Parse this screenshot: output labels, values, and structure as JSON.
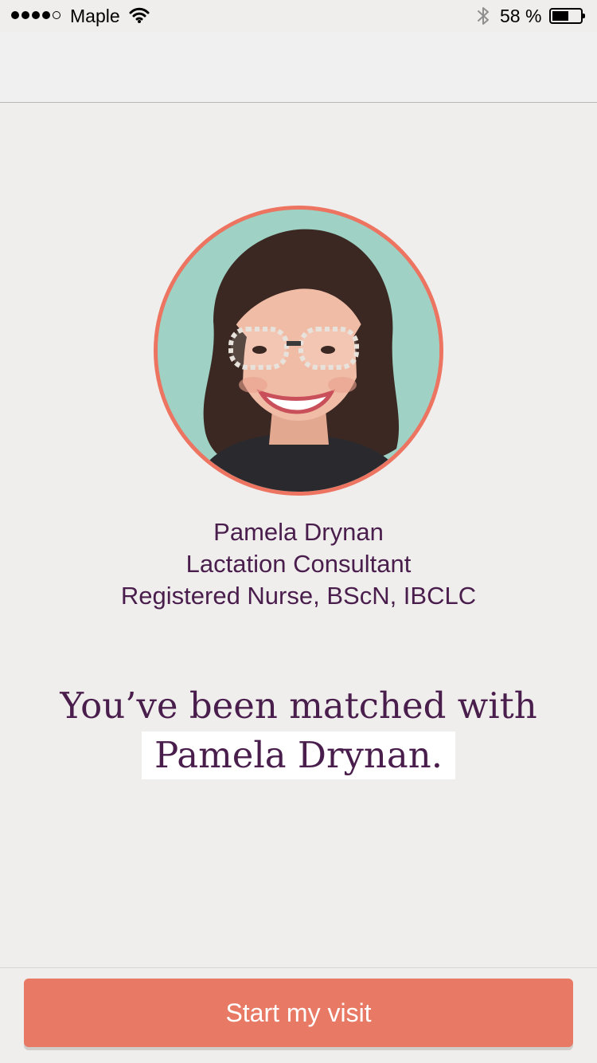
{
  "status_bar": {
    "carrier": "Maple",
    "battery_percent": "58 %",
    "battery_level": 0.58,
    "signal_bars": 4,
    "signal_total": 5,
    "icons": [
      "signal-icon",
      "wifi-icon",
      "bluetooth-icon",
      "battery-icon"
    ]
  },
  "consultant": {
    "name": "Pamela Drynan",
    "role": "Lactation Consultant",
    "credentials": "Registered Nurse, BScN, IBCLC"
  },
  "match": {
    "line1": "You’ve been matched with",
    "name": "Pamela Drynan."
  },
  "actions": {
    "start_visit": "Start my visit"
  },
  "colors": {
    "accent": "#e87a65",
    "avatar_ring": "#ec7460",
    "text_primary": "#4a1e4c",
    "background": "#efeeed"
  }
}
